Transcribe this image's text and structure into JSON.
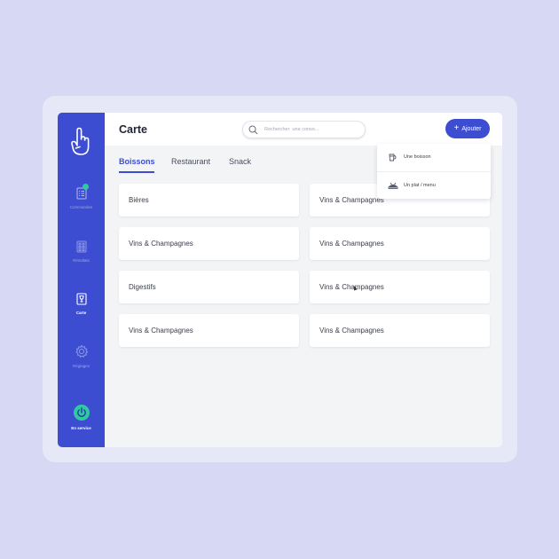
{
  "page": {
    "title": "Carte"
  },
  "colors": {
    "primary": "#3c4dd1",
    "accent": "#30c9a0",
    "background": "#d7d9f4"
  },
  "sidebar": {
    "items": [
      {
        "label": "Commandes",
        "icon": "orders-icon",
        "badge": true
      },
      {
        "label": "Résultats",
        "icon": "calculator-icon"
      },
      {
        "label": "Carte",
        "icon": "menu-card-icon",
        "active": true
      },
      {
        "label": "Réglages",
        "icon": "gear-icon"
      },
      {
        "label": "En service",
        "icon": "power-icon",
        "status": "on"
      }
    ]
  },
  "search": {
    "placeholder": "Rechercher  une conso..."
  },
  "add_button": {
    "label": "Ajouter"
  },
  "tabs": [
    {
      "label": "Boissons",
      "active": true
    },
    {
      "label": "Restaurant"
    },
    {
      "label": "Snack"
    }
  ],
  "cards": [
    "Bières",
    "Vins & Champagnes",
    "Vins & Champagnes",
    "Vins & Champagnes",
    "Digestifs",
    "Vins & Champagnes",
    "Vins & Champagnes",
    "Vins & Champagnes"
  ],
  "dropdown": {
    "items": [
      {
        "label": "Une boisson",
        "icon": "drink-icon"
      },
      {
        "label": "Un plat / menu",
        "icon": "dish-icon"
      }
    ]
  }
}
